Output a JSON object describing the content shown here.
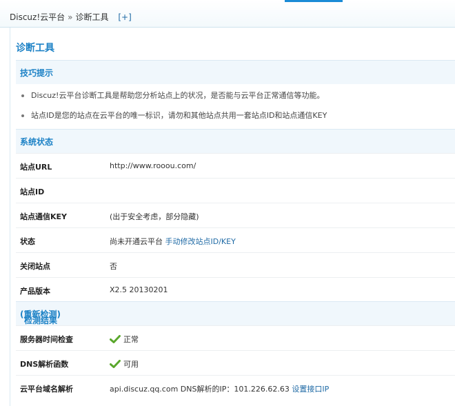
{
  "breadcrumb": {
    "root": "Discuz!云平台",
    "separator": "»",
    "current": "诊断工具",
    "expand": "[+]"
  },
  "page_title": "诊断工具",
  "tips_section": {
    "title": "技巧提示",
    "items": [
      "Discuz!云平台诊断工具是帮助您分析站点上的状况，是否能与云平台正常通信等功能。",
      "站点ID是您的站点在云平台的唯一标识，请勿和其他站点共用一套站点ID和站点通信KEY"
    ]
  },
  "status_section": {
    "title": "系统状态",
    "rows": [
      {
        "label": "站点URL",
        "value": "http://www.rooou.com/"
      },
      {
        "label": "站点ID",
        "value": ""
      },
      {
        "label": "站点通信KEY",
        "value": "(出于安全考虑，部分隐藏)"
      },
      {
        "label": "状态",
        "value": "尚未开通云平台",
        "link": "手动修改站点ID/KEY"
      },
      {
        "label": "关闭站点",
        "value": "否"
      },
      {
        "label": "产品版本",
        "value": "X2.5 20130201"
      }
    ]
  },
  "results_section": {
    "title": "检测结果",
    "retest_link": "(重新检测)",
    "rows": [
      {
        "label": "服务器时间检查",
        "value": "正常",
        "icon": "check-icon"
      },
      {
        "label": "DNS解析函数",
        "value": "可用",
        "icon": "check-icon"
      },
      {
        "label": "云平台域名解析",
        "value": "api.discuz.qq.com DNS解析的IP：101.226.62.63",
        "link": "设置接口IP"
      }
    ]
  },
  "colors": {
    "accent": "#1d82c6",
    "link": "#1f6aa5",
    "section_bg": "#f0f7fc",
    "check": "#5aa72c"
  }
}
